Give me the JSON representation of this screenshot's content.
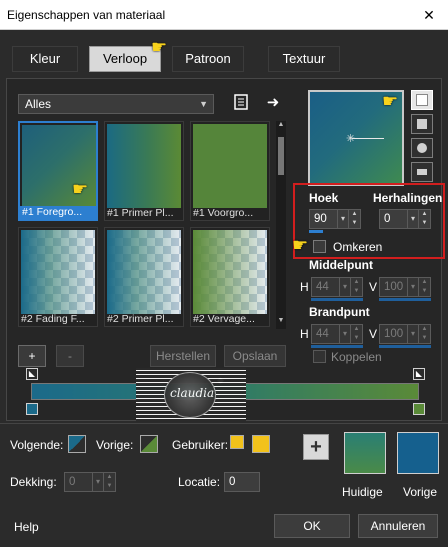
{
  "window": {
    "title": "Eigenschappen van materiaal",
    "close_glyph": "✕"
  },
  "tabs": [
    {
      "label": "Kleur",
      "active": false
    },
    {
      "label": "Verloop",
      "active": true
    },
    {
      "label": "Patroon",
      "active": false
    },
    {
      "label": "Textuur",
      "active": false
    }
  ],
  "library": {
    "selected": "Alles",
    "tiles": [
      {
        "label": "#1 Foregro...",
        "style": "diagonal-gradient",
        "selected": true
      },
      {
        "label": "#1 Primer Pl...",
        "style": "horizontal-gradient",
        "selected": false
      },
      {
        "label": "#1 Voorgro...",
        "style": "solid-green",
        "selected": false
      },
      {
        "label": "#2 Fading F...",
        "style": "fade-checker",
        "selected": false
      },
      {
        "label": "#2 Primer Pl...",
        "style": "fade-checker",
        "selected": false
      },
      {
        "label": "#2 Vervage...",
        "style": "fade-checker",
        "selected": false
      }
    ]
  },
  "angle": {
    "label": "Hoek",
    "value": "90"
  },
  "repeats": {
    "label": "Herhalingen",
    "value": "0"
  },
  "reverse": {
    "label": "Omkeren",
    "checked": false
  },
  "center_point": {
    "label": "Middelpunt",
    "h_label": "H",
    "h_value": "44",
    "v_label": "V",
    "v_value": "100"
  },
  "focal_point": {
    "label": "Brandpunt",
    "h_label": "H",
    "h_value": "44",
    "v_label": "V",
    "v_value": "100"
  },
  "link": {
    "label": "Koppelen",
    "checked": false
  },
  "buttons": {
    "add": "+",
    "remove": "-",
    "reset": "Herstellen",
    "save": "Opslaan",
    "ok": "OK",
    "cancel": "Annuleren",
    "help": "Help"
  },
  "watermark": {
    "text": "claudia"
  },
  "bottom": {
    "next_label": "Volgende:",
    "prev_label": "Vorige:",
    "user_label": "Gebruiker:",
    "opacity_label": "Dekking:",
    "opacity_value": "0",
    "location_label": "Locatie:",
    "location_value": "0",
    "current_label": "Huidige",
    "previous_label": "Vorige"
  },
  "colors": {
    "accent": "#2d7fd0",
    "dialog_bg": "#2b2b2b",
    "highlight_box": "#d21e1e",
    "gradient_start": "#1b6a8a",
    "gradient_end": "#5a8a38",
    "user_color": "#f2c21b",
    "current_swatch": "#2a7f74",
    "previous_swatch": "#15608e"
  },
  "icons": {
    "library-menu": "library-icon",
    "apply-arrow": "arrow-right-icon",
    "hand-cursor": "pointing-hand-icon",
    "add-material": "plus-icon"
  }
}
